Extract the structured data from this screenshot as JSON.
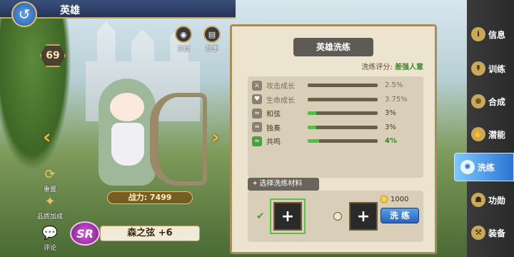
{
  "header": {
    "title": "英雄",
    "back_icon": "back-arrow-icon"
  },
  "hero": {
    "level": "69",
    "power_label": "战力: 7499",
    "rarity": "SR",
    "name": "森之弦 +6"
  },
  "top_actions": [
    {
      "label": "立绘",
      "icon": "eye-icon"
    },
    {
      "label": "故事",
      "icon": "book-icon"
    }
  ],
  "side_actions": [
    {
      "label": "重置",
      "icon": "reset-icon"
    },
    {
      "label": "品质加成",
      "icon": "quality-icon"
    },
    {
      "label": "评论",
      "icon": "comment-icon"
    }
  ],
  "panel": {
    "title": "英雄洗练",
    "score_label": "洗练评分:",
    "score_value": "差强人意",
    "stats": [
      {
        "name": "攻击成长",
        "value": "2.5%",
        "fill": 0.0,
        "active": false
      },
      {
        "name": "生命成长",
        "value": "3.75%",
        "fill": 0.0,
        "active": false
      },
      {
        "name": "和弦",
        "value": "3%",
        "fill": 0.12,
        "active": true
      },
      {
        "name": "独奏",
        "value": "3%",
        "fill": 0.12,
        "active": true
      },
      {
        "name": "共鸣",
        "value": "4%",
        "fill": 0.16,
        "active": true,
        "highlight": true
      }
    ],
    "material_title": "选择洗练材料",
    "slot_symbol": "+",
    "cost": "1000",
    "wash_button": "洗 练"
  },
  "tabs": [
    {
      "label": "信息",
      "icon": "info-icon"
    },
    {
      "label": "训练",
      "icon": "train-icon"
    },
    {
      "label": "合成",
      "icon": "merge-icon"
    },
    {
      "label": "潜能",
      "icon": "potential-icon"
    },
    {
      "label": "洗练",
      "icon": "wash-icon",
      "active": true
    },
    {
      "label": "功勋",
      "icon": "medal-icon"
    },
    {
      "label": "装备",
      "icon": "equip-icon"
    }
  ],
  "colors": {
    "accent_gold": "#c9a85a",
    "active_tab": "#2a74d0",
    "progress": "#4ec04a"
  }
}
